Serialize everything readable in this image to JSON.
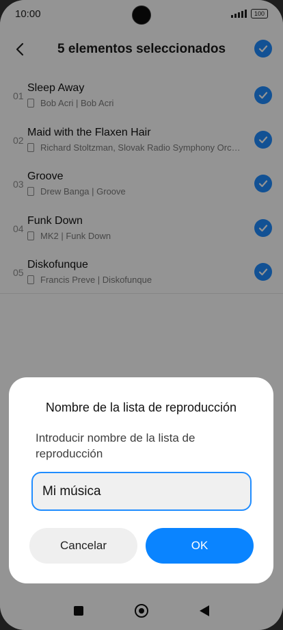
{
  "status_bar": {
    "time": "10:00",
    "battery": "100"
  },
  "header": {
    "title": "5 elementos seleccionados"
  },
  "songs": [
    {
      "index": "01",
      "title": "Sleep Away",
      "subtitle": "Bob Acri | Bob Acri"
    },
    {
      "index": "02",
      "title": "Maid with the Flaxen Hair",
      "subtitle": "Richard Stoltzman, Slovak Radio Symphony Orc…"
    },
    {
      "index": "03",
      "title": "Groove",
      "subtitle": "Drew Banga | Groove"
    },
    {
      "index": "04",
      "title": "Funk Down",
      "subtitle": "MK2 | Funk Down"
    },
    {
      "index": "05",
      "title": "Diskofunque",
      "subtitle": "Francis Preve | Diskofunque"
    }
  ],
  "dialog": {
    "title": "Nombre de la lista de reproducción",
    "message": "Introducir nombre de la lista de reproducción",
    "input_value": "Mi música",
    "cancel_label": "Cancelar",
    "ok_label": "OK"
  },
  "colors": {
    "accent": "#1f8cff",
    "ok_button": "#0a84ff",
    "scrim": "rgba(0,0,0,0.42)"
  },
  "icons": {
    "back": "chevron-left-icon",
    "select_all": "checkmark-circle-icon",
    "item_check": "checkmark-circle-icon",
    "device": "phone-icon",
    "nav_recents": "square-icon",
    "nav_home": "home-circle-icon",
    "nav_back": "triangle-back-icon"
  }
}
